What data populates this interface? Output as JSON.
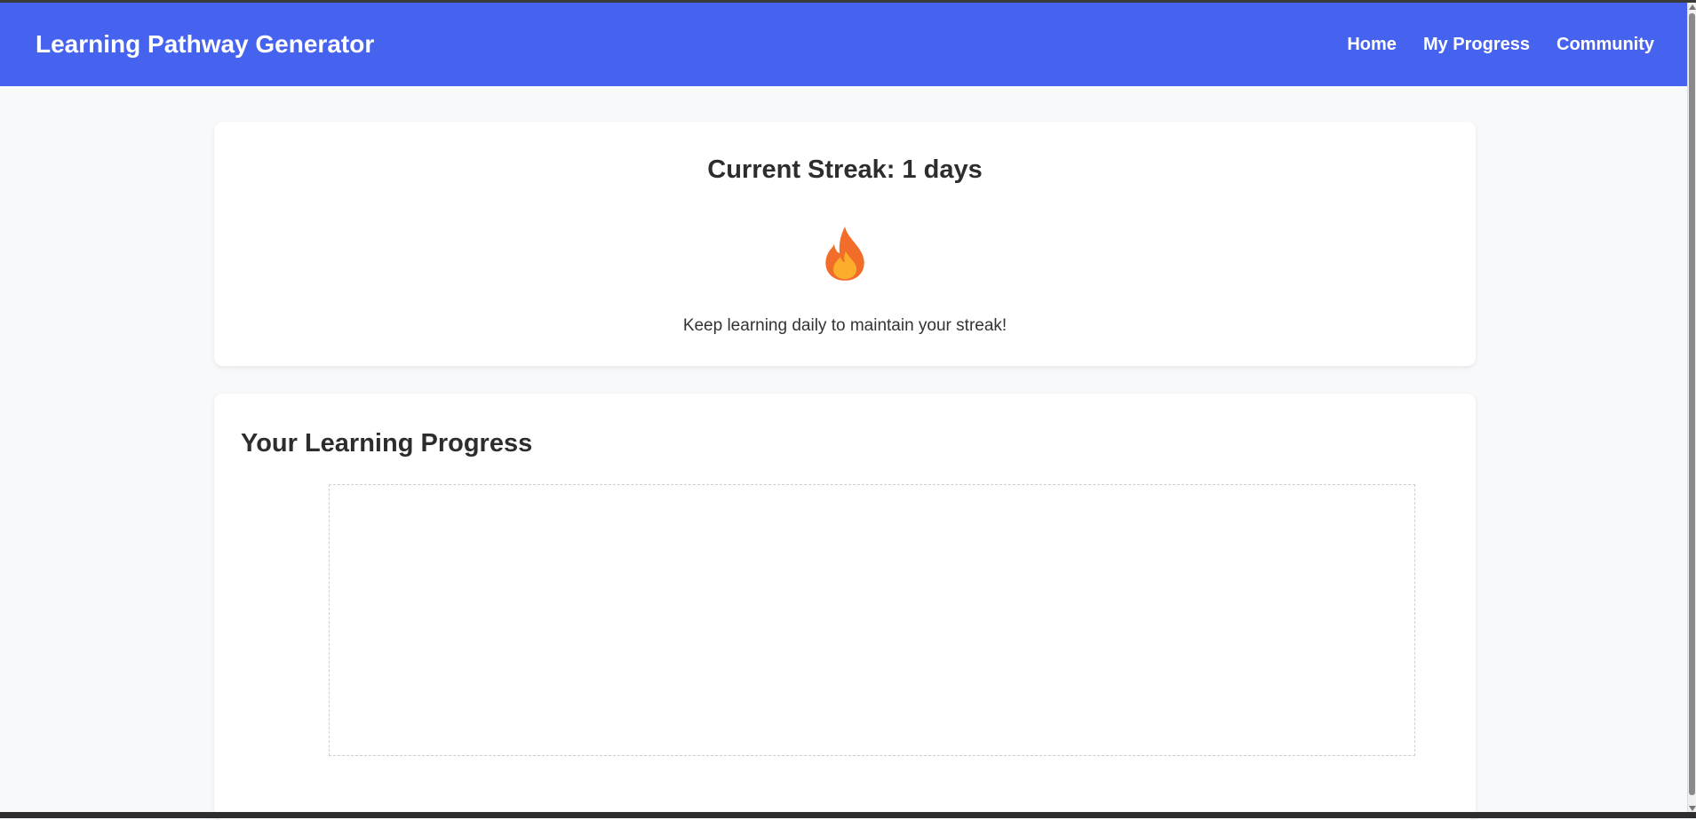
{
  "header": {
    "brand": "Learning Pathway Generator",
    "nav": [
      {
        "label": "Home"
      },
      {
        "label": "My Progress"
      },
      {
        "label": "Community"
      }
    ],
    "background_color": "#4663f0"
  },
  "streak": {
    "title": "Current Streak: 1 days",
    "icon": "fire-icon",
    "message": "Keep learning daily to maintain your streak!"
  },
  "progress": {
    "title": "Your Learning Progress"
  }
}
